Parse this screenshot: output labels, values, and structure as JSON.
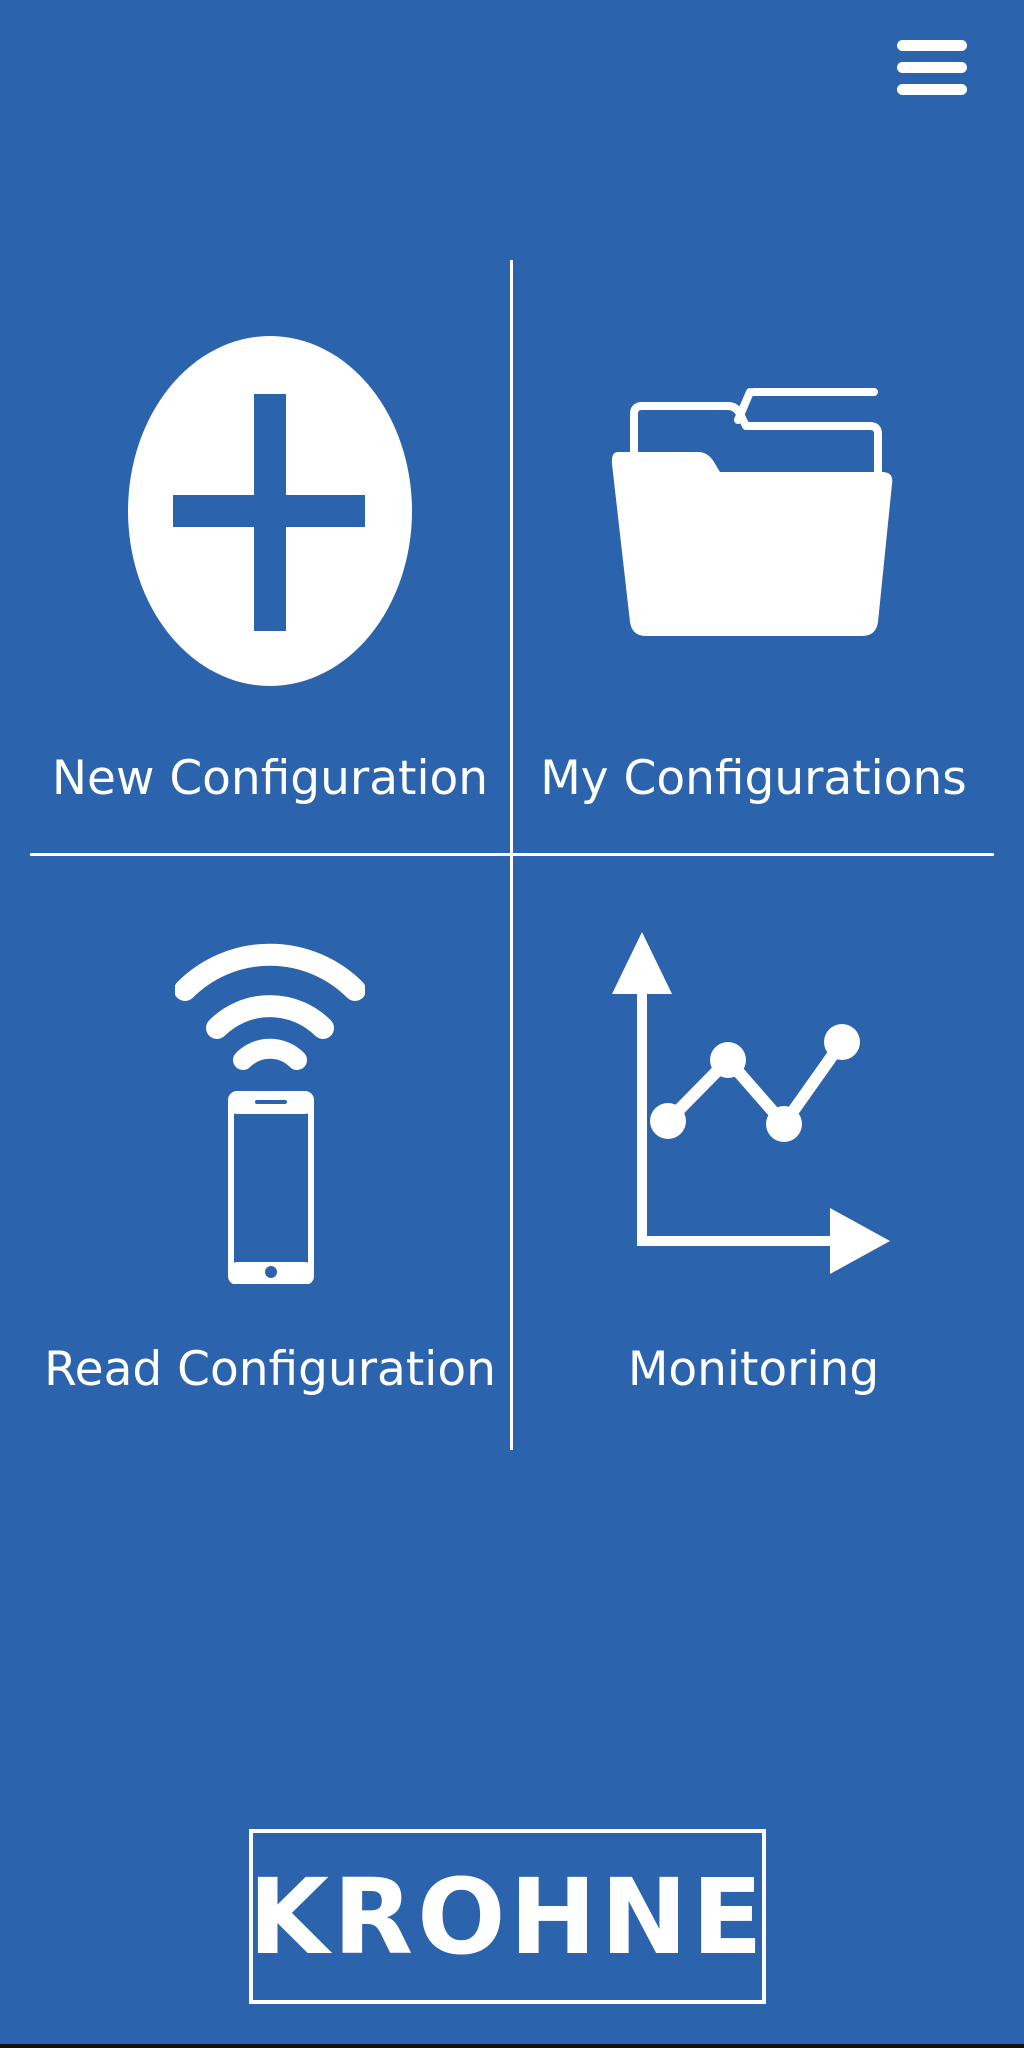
{
  "colors": {
    "background": "#2b63ac",
    "foreground": "#ffffff"
  },
  "header": {
    "menu_icon": "hamburger-menu-icon"
  },
  "tiles": [
    {
      "label": "New Configuration",
      "icon": "plus-circle-icon"
    },
    {
      "label": "My Configurations",
      "icon": "folder-icon"
    },
    {
      "label": "Read Configuration",
      "icon": "phone-wireless-icon"
    },
    {
      "label": "Monitoring",
      "icon": "line-chart-icon"
    }
  ],
  "footer": {
    "logo_text": "KROHNE"
  }
}
